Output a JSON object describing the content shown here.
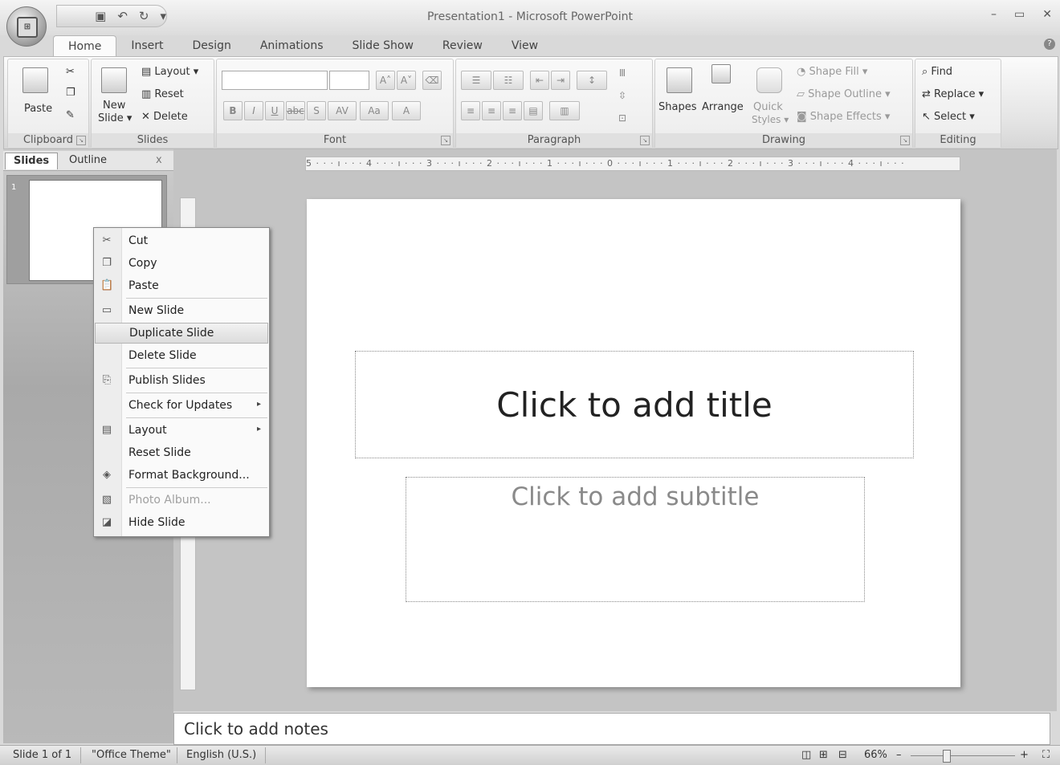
{
  "window": {
    "title": "Presentation1 - Microsoft PowerPoint",
    "controls": [
      "–",
      "▭",
      "✕"
    ]
  },
  "qat": {
    "icons": [
      "save-icon",
      "undo-icon",
      "redo-icon",
      "customize-icon"
    ]
  },
  "tabs": [
    "Home",
    "Insert",
    "Design",
    "Animations",
    "Slide Show",
    "Review",
    "View"
  ],
  "ribbon": {
    "clipboard": {
      "label": "Clipboard",
      "paste": "Paste"
    },
    "slides": {
      "label": "Slides",
      "new_slide": "New",
      "new_slide2": "Slide ▾",
      "layout": "Layout ▾",
      "reset": "Reset",
      "delete": "Delete"
    },
    "font": {
      "label": "Font",
      "bold": "B",
      "italic": "I",
      "underline": "U",
      "strike": "abc",
      "shadow": "S",
      "spacing": "AV",
      "case": "Aa",
      "color": "A",
      "grow": "A˄",
      "shrink": "A˅"
    },
    "paragraph": {
      "label": "Paragraph"
    },
    "drawing": {
      "label": "Drawing",
      "shapes": "Shapes",
      "arrange": "Arrange",
      "quick1": "Quick",
      "quick2": "Styles ▾",
      "fill": "Shape Fill ▾",
      "outline": "Shape Outline ▾",
      "effects": "Shape Effects ▾"
    },
    "editing": {
      "label": "Editing",
      "find": "Find",
      "replace": "Replace ▾",
      "select": "Select ▾"
    }
  },
  "left_pane": {
    "tab_slides": "Slides",
    "tab_outline": "Outline",
    "close": "x",
    "thumb_number": "1"
  },
  "ruler": {
    "horizontal": "5 · · · ı · · · 4 · · · ı · · · 3 · · · ı · · · 2 · · · ı · · · 1 · · · ı · · · 0 · · · ı · · · 1 · · · ı · · · 2 · · · ı · · · 3 · · · ı · · · 4 · · · ı · · ·"
  },
  "slide": {
    "title_placeholder": "Click to add title",
    "subtitle_placeholder": "Click to add subtitle"
  },
  "notes": {
    "placeholder": "Click to add notes"
  },
  "context_menu": {
    "items": [
      {
        "label": "Cut",
        "icon": "✂",
        "enabled": true
      },
      {
        "label": "Copy",
        "icon": "❐",
        "enabled": true
      },
      {
        "label": "Paste",
        "icon": "📋",
        "enabled": true
      },
      {
        "label": "New Slide",
        "icon": "▭",
        "enabled": true
      },
      {
        "label": "Duplicate Slide",
        "icon": "",
        "enabled": true
      },
      {
        "label": "Delete Slide",
        "icon": "",
        "enabled": true
      },
      {
        "label": "Publish Slides",
        "icon": "⎘",
        "enabled": true
      },
      {
        "label": "Check for Updates",
        "icon": "",
        "enabled": true,
        "submenu": "▸"
      },
      {
        "label": "Layout",
        "icon": "▤",
        "enabled": true,
        "submenu": "▸"
      },
      {
        "label": "Reset Slide",
        "icon": "",
        "enabled": true
      },
      {
        "label": "Format Background...",
        "icon": "◈",
        "enabled": true
      },
      {
        "label": "Photo Album...",
        "icon": "▧",
        "enabled": false
      },
      {
        "label": "Hide Slide",
        "icon": "◪",
        "enabled": true
      }
    ]
  },
  "status_bar": {
    "slide_info": "Slide 1 of 1",
    "theme": "\"Office Theme\"",
    "language": "English (U.S.)",
    "zoom": "66%",
    "zoom_minus": "–",
    "zoom_plus": "+"
  }
}
